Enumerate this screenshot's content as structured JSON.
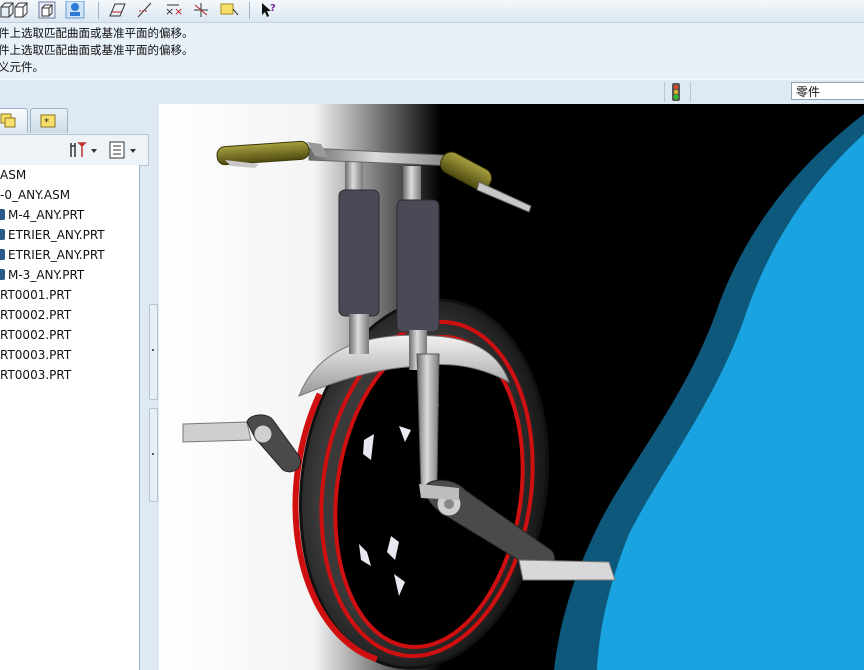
{
  "messages": [
    "件上选取匹配曲面或基准平面的偏移。",
    "件上选取匹配曲面或基准平面的偏移。",
    "义元件。"
  ],
  "filter": {
    "value": "零件"
  },
  "tree": {
    "items": [
      {
        "label": "ASM",
        "icon": "assembly-icon"
      },
      {
        "label": "-0_ANY.ASM",
        "icon": "assembly-icon"
      },
      {
        "label": "M-4_ANY.PRT",
        "icon": "part-icon"
      },
      {
        "label": "ETRIER_ANY.PRT",
        "icon": "part-icon"
      },
      {
        "label": "ETRIER_ANY.PRT",
        "icon": "part-icon"
      },
      {
        "label": "M-3_ANY.PRT",
        "icon": "part-icon"
      },
      {
        "label": "RT0001.PRT",
        "icon": "part-icon"
      },
      {
        "label": "RT0002.PRT",
        "icon": "part-icon"
      },
      {
        "label": "RT0002.PRT",
        "icon": "part-icon"
      },
      {
        "label": "RT0003.PRT",
        "icon": "part-icon"
      },
      {
        "label": "RT0003.PRT",
        "icon": "part-icon"
      }
    ]
  },
  "colors": {
    "viewport_bg_left": "#ffffff",
    "viewport_bg_mid": "#000000",
    "viewport_bg_right": "#19a3e0",
    "tire_stripe": "#d01010",
    "grip": "#6e6a1e"
  }
}
